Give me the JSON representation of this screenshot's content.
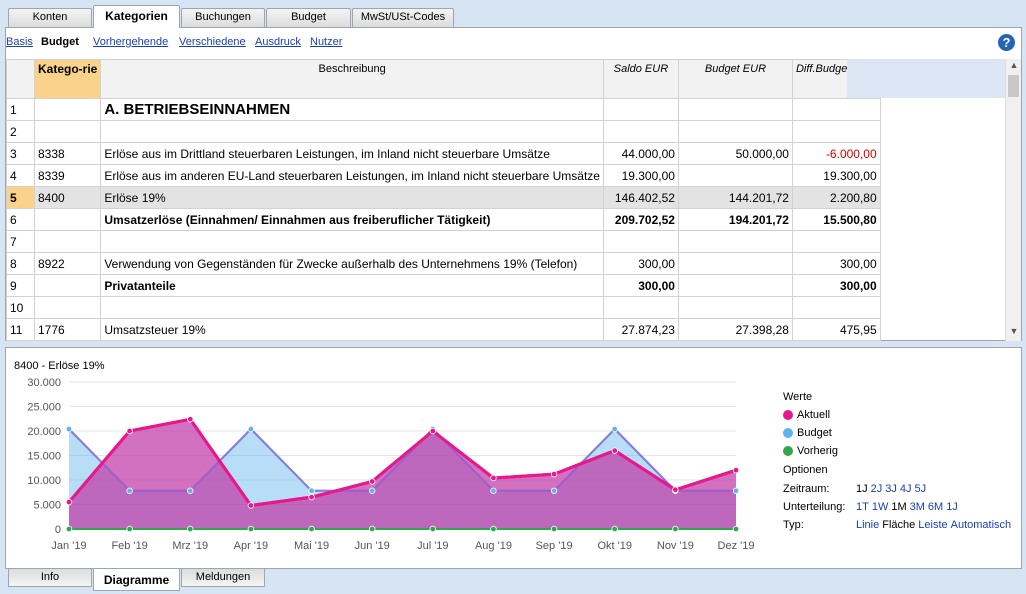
{
  "top_tabs": [
    "Konten",
    "Kategorien",
    "Buchungen",
    "Budget",
    "MwSt/USt-Codes"
  ],
  "views": [
    "Basis",
    "Budget",
    "Vorhergehende",
    "Verschiedene",
    "Ausdruck",
    "Nutzer"
  ],
  "help": "?",
  "table": {
    "headers": {
      "cat": "Katego-rie",
      "desc": "Beschreibung",
      "saldo": "Saldo EUR",
      "budget": "Budget EUR",
      "diff": "Diff.Budget EUR"
    },
    "rows": [
      {
        "n": "1",
        "cat": "",
        "desc": "A. BETRIEBSEINNAHMEN",
        "saldo": "",
        "budget": "",
        "diff": ""
      },
      {
        "n": "2",
        "cat": "",
        "desc": "",
        "saldo": "",
        "budget": "",
        "diff": ""
      },
      {
        "n": "3",
        "cat": "8338",
        "desc": "Erlöse aus im Drittland steuerbaren Leistungen, im Inland nicht steuerbare Umsätze",
        "saldo": "44.000,00",
        "budget": "50.000,00",
        "diff": "-6.000,00"
      },
      {
        "n": "4",
        "cat": "8339",
        "desc": "Erlöse aus im anderen EU-Land steuerbaren Leistungen, im Inland nicht steuerbare Umsätze",
        "saldo": "19.300,00",
        "budget": "",
        "diff": "19.300,00"
      },
      {
        "n": "5",
        "cat": "8400",
        "desc": "Erlöse 19%",
        "saldo": "146.402,52",
        "budget": "144.201,72",
        "diff": "2.200,80"
      },
      {
        "n": "6",
        "cat": "",
        "desc": "Umsatzerlöse (Einnahmen/ Einnahmen aus freiberuflicher Tätigkeit)",
        "saldo": "209.702,52",
        "budget": "194.201,72",
        "diff": "15.500,80"
      },
      {
        "n": "7",
        "cat": "",
        "desc": "",
        "saldo": "",
        "budget": "",
        "diff": ""
      },
      {
        "n": "8",
        "cat": "8922",
        "desc": "Verwendung von Gegenständen für Zwecke außerhalb des Unternehmens 19% (Telefon)",
        "saldo": "300,00",
        "budget": "",
        "diff": "300,00"
      },
      {
        "n": "9",
        "cat": "",
        "desc": "Privatanteile",
        "saldo": "300,00",
        "budget": "",
        "diff": "300,00"
      },
      {
        "n": "10",
        "cat": "",
        "desc": "",
        "saldo": "",
        "budget": "",
        "diff": ""
      },
      {
        "n": "11",
        "cat": "1776",
        "desc": "Umsatzsteuer 19%",
        "saldo": "27.874,23",
        "budget": "27.398,28",
        "diff": "475,95"
      }
    ]
  },
  "chart_data": {
    "type": "area",
    "title": "8400 - Erlöse 19%",
    "categories": [
      "Jan '19",
      "Feb '19",
      "Mrz '19",
      "Apr '19",
      "Mai '19",
      "Jun '19",
      "Jul '19",
      "Aug '19",
      "Sep '19",
      "Okt '19",
      "Nov '19",
      "Dez '19"
    ],
    "yticks": [
      "30.000",
      "25.000",
      "20.000",
      "15.000",
      "10.000",
      "5.000",
      "0"
    ],
    "ylim": [
      0,
      30000
    ],
    "legend_title": "Werte",
    "series": [
      {
        "name": "Aktuell",
        "color": "#e8178a",
        "values": [
          5500,
          20000,
          22400,
          4800,
          6500,
          9700,
          20000,
          10400,
          11200,
          16000,
          8000,
          12000
        ]
      },
      {
        "name": "Budget",
        "color": "#5fb4ee",
        "values": [
          20400,
          7800,
          7800,
          20400,
          7800,
          7800,
          20400,
          7800,
          7800,
          20400,
          7800,
          7800
        ]
      },
      {
        "name": "Vorherig",
        "color": "#2ea84a",
        "values": [
          0,
          0,
          0,
          0,
          0,
          0,
          0,
          0,
          0,
          0,
          0,
          0
        ]
      }
    ]
  },
  "options": {
    "title": "Optionen",
    "zeitraum_label": "Zeitraum:",
    "zeitraum": [
      "1J",
      "2J",
      "3J",
      "4J",
      "5J"
    ],
    "unterteilung_label": "Unterteilung:",
    "unterteilung": [
      "1T",
      "1W",
      "1M",
      "3M",
      "6M",
      "1J"
    ],
    "typ_label": "Typ:",
    "typ": [
      "Linie",
      "Fläche",
      "Leiste",
      "Automatisch"
    ]
  },
  "bottom_tabs": [
    "Info",
    "Diagramme",
    "Meldungen"
  ]
}
